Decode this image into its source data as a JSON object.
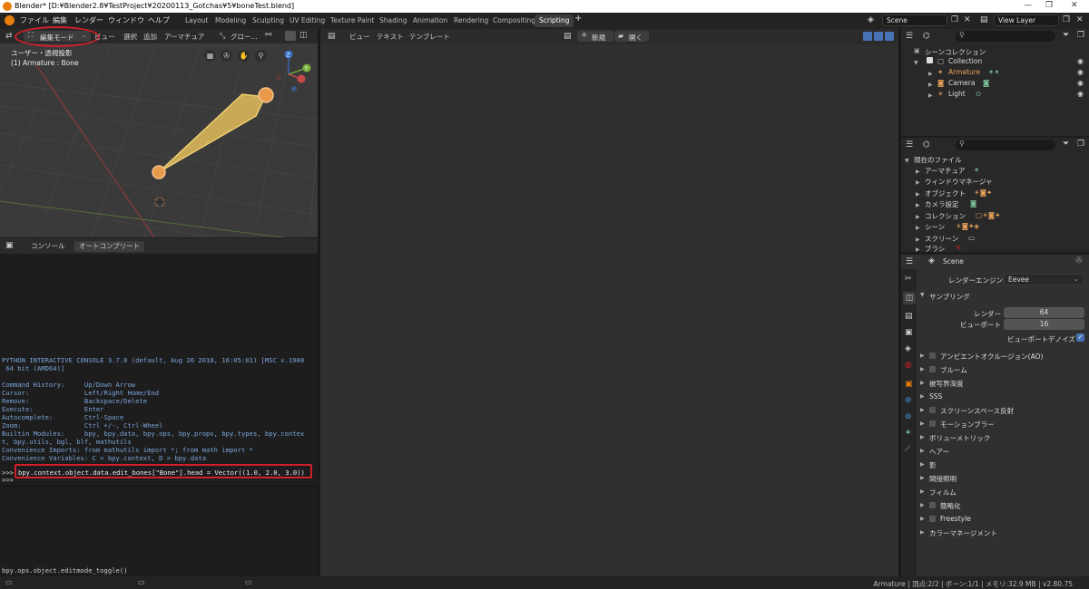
{
  "window": {
    "title": "Blender* [D:¥Blender2.8¥TestProject¥20200113_Gotchas¥5¥boneTest.blend]"
  },
  "menu": [
    "ファイル",
    "編集",
    "レンダー",
    "ウィンドウ",
    "ヘルプ"
  ],
  "workspaces": [
    "Layout",
    "Modeling",
    "Sculpting",
    "UV Editing",
    "Texture Paint",
    "Shading",
    "Animation",
    "Rendering",
    "Compositing",
    "Scripting"
  ],
  "active_workspace": "Scripting",
  "scene_field": "Scene",
  "view_layer_field": "View Layer",
  "viewport": {
    "mode": "編集モード",
    "menu": [
      "ビュー",
      "選択",
      "追加",
      "アーマチュア"
    ],
    "transform": "グロー...",
    "overlay_line1": "ユーザー・透視投影",
    "overlay_line2": "(1) Armature : Bone",
    "gizmo": [
      "Z",
      "Y",
      "X"
    ]
  },
  "console": {
    "tabs": [
      "コンソール",
      "オートコンプリート"
    ],
    "banner": [
      "PYTHON INTERACTIVE CONSOLE 3.7.0 (default, Aug 26 2018, 16:05:01) [MSC v.1900",
      " 64 bit (AMD64)]",
      "",
      "Command History:     Up/Down Arrow",
      "Cursor:              Left/Right Home/End",
      "Remove:              Backspace/Delete",
      "Execute:             Enter",
      "Autocomplete:        Ctrl-Space",
      "Zoom:                Ctrl +/-, Ctrl-Wheel",
      "Builtin Modules:     bpy, bpy.data, bpy.ops, bpy.props, bpy.types, bpy.contex",
      "t, bpy.utils, bgl, blf, mathutils",
      "Convenience Imports: from mathutils import *; from math import *",
      "Convenience Variables: C = bpy.context, D = bpy.data"
    ],
    "prompt": ">>>",
    "command": "bpy.context.object.data.edit_bones[\"Bone\"].head = Vector((1.0, 2.0, 3.0))",
    "prompt2": ">>>"
  },
  "info": {
    "line": "bpy.ops.object.editmode_toggle()"
  },
  "text_editor": {
    "menu": [
      "ビュー",
      "テキスト",
      "テンプレート"
    ],
    "new_label": "新規",
    "open_label": "開く"
  },
  "outliner": {
    "root": "シーンコレクション",
    "collection": "Collection",
    "items": [
      "Armature",
      "Camera",
      "Light"
    ]
  },
  "file_view": {
    "root": "現在のファイル",
    "items": [
      "アーマチュア",
      "ウィンドウマネージャ",
      "オブジェクト",
      "カメラ設定",
      "コレクション",
      "シーン",
      "スクリーン",
      "ブラシ"
    ]
  },
  "properties": {
    "scene_label": "Scene",
    "render_engine_label": "レンダーエンジン",
    "render_engine_value": "Eevee",
    "sampling_label": "サンプリング",
    "render_label": "レンダー",
    "render_value": "64",
    "viewport_label": "ビューポート",
    "viewport_value": "16",
    "viewport_denoise_label": "ビューポートデノイズ",
    "panels": [
      {
        "label": "アンビエントオクルージョン(AO)",
        "checkbox": true
      },
      {
        "label": "ブルーム",
        "checkbox": true
      },
      {
        "label": "被写界深度",
        "checkbox": false
      },
      {
        "label": "SSS",
        "checkbox": false
      },
      {
        "label": "スクリーンスペース反射",
        "checkbox": true
      },
      {
        "label": "モーションブラー",
        "checkbox": true
      },
      {
        "label": "ボリューメトリック",
        "checkbox": false
      },
      {
        "label": "ヘアー",
        "checkbox": false
      },
      {
        "label": "影",
        "checkbox": false
      },
      {
        "label": "間接照明",
        "checkbox": false
      },
      {
        "label": "フィルム",
        "checkbox": false
      },
      {
        "label": "簡略化",
        "checkbox": true
      },
      {
        "label": "Freestyle",
        "checkbox": true
      },
      {
        "label": "カラーマネージメント",
        "checkbox": false
      }
    ]
  },
  "status": {
    "text": "Armature | 頂点:2/2 | ボーン:1/1 | メモリ:32.9 MB | v2.80.75"
  },
  "colors": {
    "accent_orange": "#e87d0d",
    "highlight_red": "#d0202a",
    "console_blue": "#7aa6da"
  }
}
